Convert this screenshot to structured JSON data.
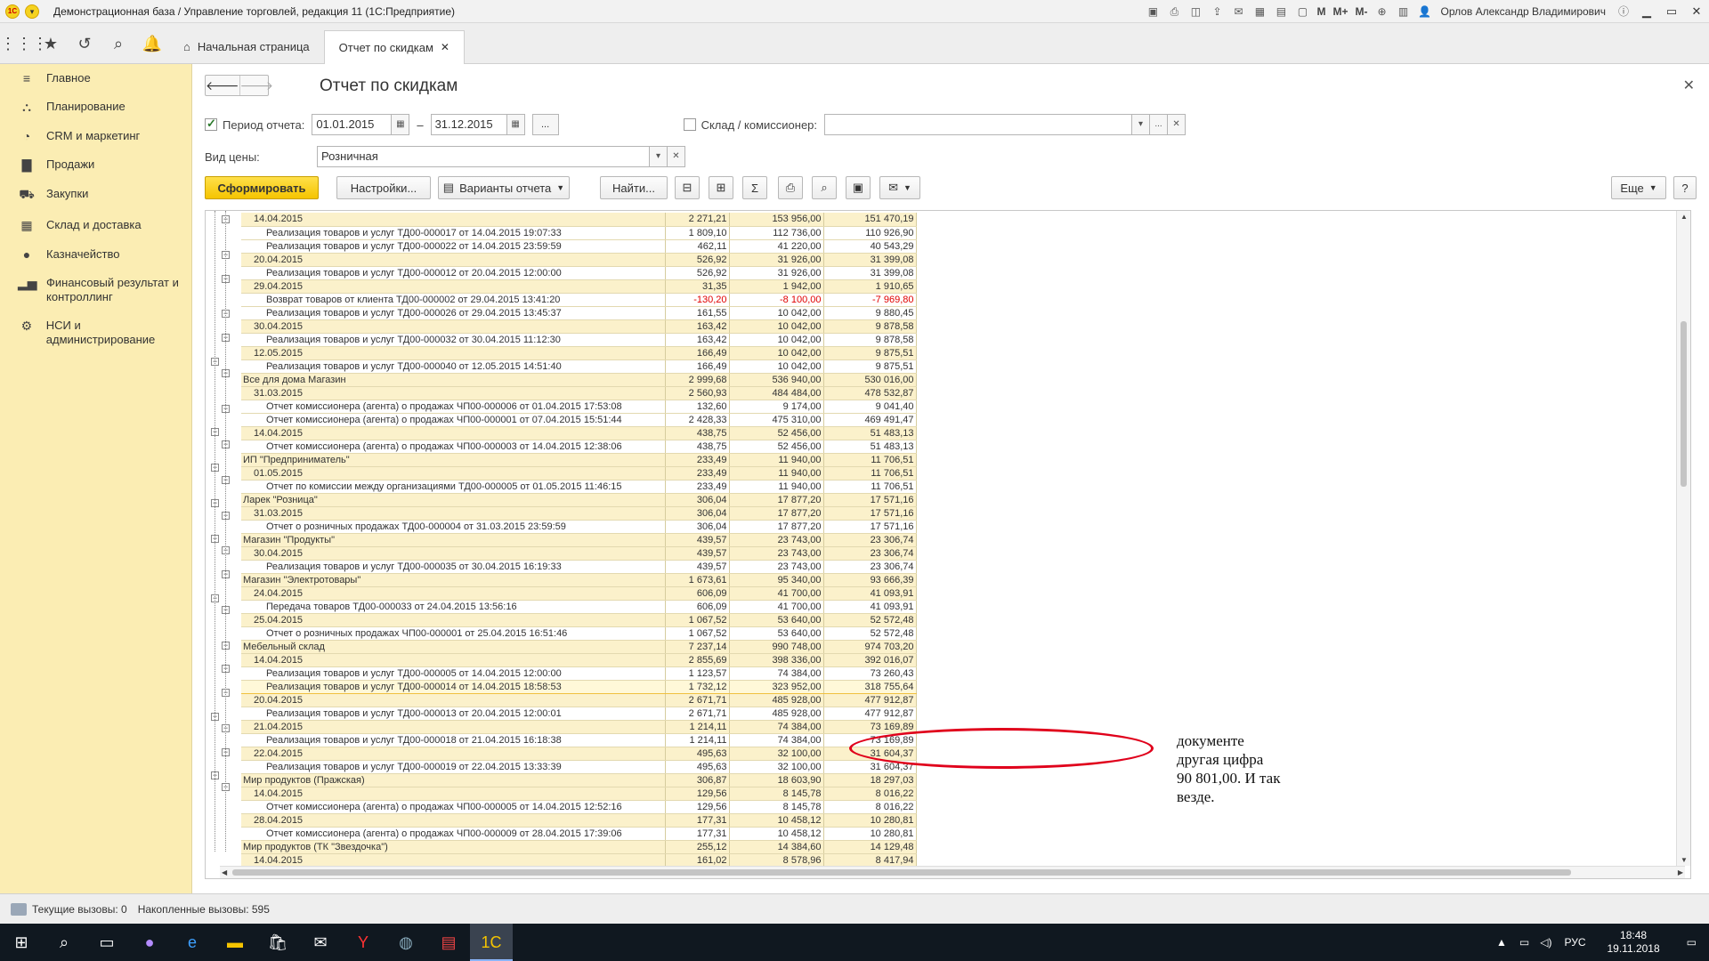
{
  "titlebar": {
    "title": "Демонстрационная база / Управление торговлей, редакция 11  (1С:Предприятие)",
    "user": "Орлов Александр Владимирович",
    "m1": "M",
    "m2": "M+",
    "m3": "M-"
  },
  "navbar": {
    "home_tab": "Начальная страница",
    "report_tab": "Отчет по скидкам"
  },
  "sidebar": {
    "items": [
      {
        "label": "Главное",
        "icon": "menu-icon"
      },
      {
        "label": "Планирование",
        "icon": "planning-icon"
      },
      {
        "label": "CRM и маркетинг",
        "icon": "crm-icon"
      },
      {
        "label": "Продажи",
        "icon": "bag-icon"
      },
      {
        "label": "Закупки",
        "icon": "cart-icon"
      },
      {
        "label": "Склад и доставка",
        "icon": "warehouse-icon"
      },
      {
        "label": "Казначейство",
        "icon": "coin-icon"
      },
      {
        "label": "Финансовый результат и контроллинг",
        "icon": "chart-icon"
      },
      {
        "label": "НСИ и администрирование",
        "icon": "gear-icon"
      }
    ]
  },
  "main": {
    "title": "Отчет по скидкам",
    "period_label": "Период отчета:",
    "period_from": "01.01.2015",
    "period_to": "31.12.2015",
    "dash": "–",
    "dots": "...",
    "warehouse_label": "Склад / комиссионер:",
    "warehouse_value": "",
    "price_label": "Вид цены:",
    "price_value": "Розничная"
  },
  "toolbar": {
    "generate": "Сформировать",
    "settings": "Настройки...",
    "variants": "Варианты отчета",
    "find": "Найти...",
    "more": "Еще",
    "help": "?"
  },
  "report": {
    "rows": [
      {
        "level": 1,
        "name": "14.04.2015",
        "v1": "2 271,21",
        "v2": "153 956,00",
        "v3": "151 470,19"
      },
      {
        "level": 2,
        "name": "Реализация товаров и услуг ТД00-000017 от 14.04.2015 19:07:33",
        "v1": "1 809,10",
        "v2": "112 736,00",
        "v3": "110 926,90"
      },
      {
        "level": 2,
        "name": "Реализация товаров и услуг ТД00-000022 от 14.04.2015 23:59:59",
        "v1": "462,11",
        "v2": "41 220,00",
        "v3": "40 543,29"
      },
      {
        "level": 1,
        "name": "20.04.2015",
        "v1": "526,92",
        "v2": "31 926,00",
        "v3": "31 399,08"
      },
      {
        "level": 2,
        "name": "Реализация товаров и услуг ТД00-000012 от 20.04.2015 12:00:00",
        "v1": "526,92",
        "v2": "31 926,00",
        "v3": "31 399,08"
      },
      {
        "level": 1,
        "name": "29.04.2015",
        "v1": "31,35",
        "v2": "1 942,00",
        "v3": "1 910,65"
      },
      {
        "level": 2,
        "name": "Возврат товаров от клиента ТД00-000002 от 29.04.2015 13:41:20",
        "v1": "-130,20",
        "v2": "-8 100,00",
        "v3": "-7 969,80",
        "neg": true
      },
      {
        "level": 2,
        "name": "Реализация товаров и услуг ТД00-000026 от 29.04.2015 13:45:37",
        "v1": "161,55",
        "v2": "10 042,00",
        "v3": "9 880,45"
      },
      {
        "level": 1,
        "name": "30.04.2015",
        "v1": "163,42",
        "v2": "10 042,00",
        "v3": "9 878,58"
      },
      {
        "level": 2,
        "name": "Реализация товаров и услуг ТД00-000032 от 30.04.2015 11:12:30",
        "v1": "163,42",
        "v2": "10 042,00",
        "v3": "9 878,58"
      },
      {
        "level": 1,
        "name": "12.05.2015",
        "v1": "166,49",
        "v2": "10 042,00",
        "v3": "9 875,51"
      },
      {
        "level": 2,
        "name": "Реализация товаров и услуг ТД00-000040 от 12.05.2015 14:51:40",
        "v1": "166,49",
        "v2": "10 042,00",
        "v3": "9 875,51"
      },
      {
        "level": 0,
        "name": "Все для дома Магазин",
        "v1": "2 999,68",
        "v2": "536 940,00",
        "v3": "530 016,00"
      },
      {
        "level": 1,
        "name": "31.03.2015",
        "v1": "2 560,93",
        "v2": "484 484,00",
        "v3": "478 532,87"
      },
      {
        "level": 2,
        "name": "Отчет комиссионера (агента) о продажах ЧП00-000006 от 01.04.2015 17:53:08",
        "v1": "132,60",
        "v2": "9 174,00",
        "v3": "9 041,40"
      },
      {
        "level": 2,
        "name": "Отчет комиссионера (агента) о продажах ЧП00-000001 от 07.04.2015 15:51:44",
        "v1": "2 428,33",
        "v2": "475 310,00",
        "v3": "469 491,47"
      },
      {
        "level": 1,
        "name": "14.04.2015",
        "v1": "438,75",
        "v2": "52 456,00",
        "v3": "51 483,13"
      },
      {
        "level": 2,
        "name": "Отчет комиссионера (агента) о продажах ЧП00-000003 от 14.04.2015 12:38:06",
        "v1": "438,75",
        "v2": "52 456,00",
        "v3": "51 483,13"
      },
      {
        "level": 0,
        "name": "ИП \"Предприниматель\"",
        "v1": "233,49",
        "v2": "11 940,00",
        "v3": "11 706,51"
      },
      {
        "level": 1,
        "name": "01.05.2015",
        "v1": "233,49",
        "v2": "11 940,00",
        "v3": "11 706,51"
      },
      {
        "level": 2,
        "name": "Отчет по комиссии между организациями ТД00-000005 от 01.05.2015 11:46:15",
        "v1": "233,49",
        "v2": "11 940,00",
        "v3": "11 706,51"
      },
      {
        "level": 0,
        "name": "Ларек \"Розница\"",
        "v1": "306,04",
        "v2": "17 877,20",
        "v3": "17 571,16"
      },
      {
        "level": 1,
        "name": "31.03.2015",
        "v1": "306,04",
        "v2": "17 877,20",
        "v3": "17 571,16"
      },
      {
        "level": 2,
        "name": "Отчет о розничных продажах ТД00-000004 от 31.03.2015 23:59:59",
        "v1": "306,04",
        "v2": "17 877,20",
        "v3": "17 571,16"
      },
      {
        "level": 0,
        "name": "Магазин \"Продукты\"",
        "v1": "439,57",
        "v2": "23 743,00",
        "v3": "23 306,74"
      },
      {
        "level": 1,
        "name": "30.04.2015",
        "v1": "439,57",
        "v2": "23 743,00",
        "v3": "23 306,74"
      },
      {
        "level": 2,
        "name": "Реализация товаров и услуг ТД00-000035 от 30.04.2015 16:19:33",
        "v1": "439,57",
        "v2": "23 743,00",
        "v3": "23 306,74"
      },
      {
        "level": 0,
        "name": "Магазин \"Электротовары\"",
        "v1": "1 673,61",
        "v2": "95 340,00",
        "v3": "93 666,39"
      },
      {
        "level": 1,
        "name": "24.04.2015",
        "v1": "606,09",
        "v2": "41 700,00",
        "v3": "41 093,91"
      },
      {
        "level": 2,
        "name": "Передача товаров ТД00-000033 от 24.04.2015 13:56:16",
        "v1": "606,09",
        "v2": "41 700,00",
        "v3": "41 093,91"
      },
      {
        "level": 1,
        "name": "25.04.2015",
        "v1": "1 067,52",
        "v2": "53 640,00",
        "v3": "52 572,48"
      },
      {
        "level": 2,
        "name": "Отчет о розничных продажах ЧП00-000001 от 25.04.2015 16:51:46",
        "v1": "1 067,52",
        "v2": "53 640,00",
        "v3": "52 572,48"
      },
      {
        "level": 0,
        "name": "Мебельный склад",
        "v1": "7 237,14",
        "v2": "990 748,00",
        "v3": "974 703,20"
      },
      {
        "level": 1,
        "name": "14.04.2015",
        "v1": "2 855,69",
        "v2": "398 336,00",
        "v3": "392 016,07"
      },
      {
        "level": 2,
        "name": "Реализация товаров и услуг ТД00-000005 от 14.04.2015 12:00:00",
        "v1": "1 123,57",
        "v2": "74 384,00",
        "v3": "73 260,43"
      },
      {
        "level": 2,
        "name": "Реализация товаров и услуг ТД00-000014 от 14.04.2015 18:58:53",
        "v1": "1 732,12",
        "v2": "323 952,00",
        "v3": "318 755,64",
        "selected": true
      },
      {
        "level": 1,
        "name": "20.04.2015",
        "v1": "2 671,71",
        "v2": "485 928,00",
        "v3": "477 912,87"
      },
      {
        "level": 2,
        "name": "Реализация товаров и услуг ТД00-000013 от 20.04.2015 12:00:01",
        "v1": "2 671,71",
        "v2": "485 928,00",
        "v3": "477 912,87"
      },
      {
        "level": 1,
        "name": "21.04.2015",
        "v1": "1 214,11",
        "v2": "74 384,00",
        "v3": "73 169,89"
      },
      {
        "level": 2,
        "name": "Реализация товаров и услуг ТД00-000018 от 21.04.2015 16:18:38",
        "v1": "1 214,11",
        "v2": "74 384,00",
        "v3": "73 169,89"
      },
      {
        "level": 1,
        "name": "22.04.2015",
        "v1": "495,63",
        "v2": "32 100,00",
        "v3": "31 604,37"
      },
      {
        "level": 2,
        "name": "Реализация товаров и услуг ТД00-000019 от 22.04.2015 13:33:39",
        "v1": "495,63",
        "v2": "32 100,00",
        "v3": "31 604,37"
      },
      {
        "level": 0,
        "name": "Мир продуктов (Пражская)",
        "v1": "306,87",
        "v2": "18 603,90",
        "v3": "18 297,03"
      },
      {
        "level": 1,
        "name": "14.04.2015",
        "v1": "129,56",
        "v2": "8 145,78",
        "v3": "8 016,22"
      },
      {
        "level": 2,
        "name": "Отчет комиссионера (агента) о продажах ЧП00-000005 от 14.04.2015 12:52:16",
        "v1": "129,56",
        "v2": "8 145,78",
        "v3": "8 016,22"
      },
      {
        "level": 1,
        "name": "28.04.2015",
        "v1": "177,31",
        "v2": "10 458,12",
        "v3": "10 280,81"
      },
      {
        "level": 2,
        "name": "Отчет комиссионера (агента) о продажах ЧП00-000009 от 28.04.2015 17:39:06",
        "v1": "177,31",
        "v2": "10 458,12",
        "v3": "10 280,81"
      },
      {
        "level": 0,
        "name": "Мир продуктов (ТК \"Звездочка\")",
        "v1": "255,12",
        "v2": "14 384,60",
        "v3": "14 129,48"
      },
      {
        "level": 1,
        "name": "14.04.2015",
        "v1": "161,02",
        "v2": "8 578,96",
        "v3": "8 417,94"
      }
    ]
  },
  "annotation": {
    "text1": "документе",
    "text2": "другая цифра",
    "text3": "90 801,00. И так",
    "text4": "везде."
  },
  "status": {
    "current_calls": "Текущие вызовы: 0",
    "accumulated_calls": "Накопленные вызовы: 595"
  },
  "taskbar": {
    "lang": "РУС",
    "time": "18:48",
    "date": "19.11.2018"
  },
  "colors": {
    "sidebar_bg": "#fbedb3",
    "primary_button": "#f5c400",
    "group_row_bg": "#fbf1cb",
    "negative": "#e00000",
    "annotation_ellipse": "#e0001b"
  }
}
